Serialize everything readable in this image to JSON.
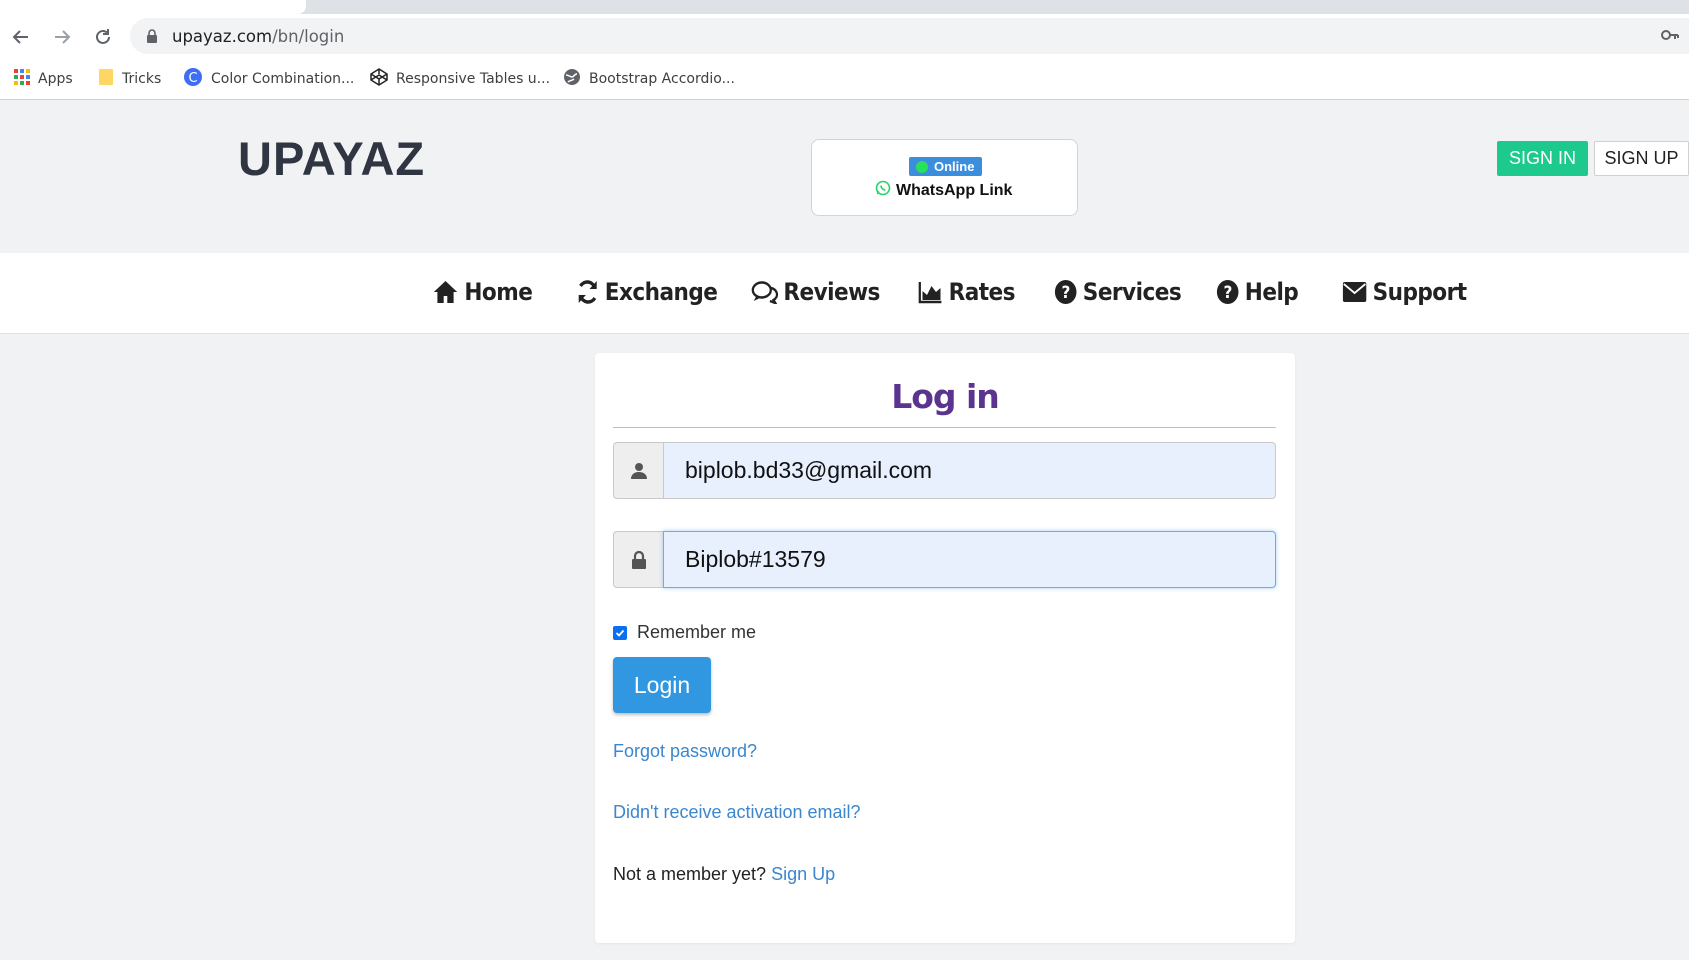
{
  "browser": {
    "url_host": "upayaz.com",
    "url_path": "/bn/login",
    "bookmarks": [
      {
        "label": "Apps",
        "icon": "apps-grid-icon"
      },
      {
        "label": "Tricks",
        "icon": "folder-icon"
      },
      {
        "label": "Color Combination...",
        "icon": "color-c-icon"
      },
      {
        "label": "Responsive Tables u...",
        "icon": "codepen-icon"
      },
      {
        "label": "Bootstrap Accordio...",
        "icon": "globe-icon"
      }
    ]
  },
  "header": {
    "logo": "UPAYAZ",
    "online_badge": "Online",
    "whatsapp_label": "WhatsApp Link",
    "sign_in": "SIGN IN",
    "sign_up": "SIGN UP"
  },
  "nav": {
    "items": [
      {
        "label": "Home",
        "icon": "home-icon"
      },
      {
        "label": "Exchange",
        "icon": "refresh-icon"
      },
      {
        "label": "Reviews",
        "icon": "comments-icon"
      },
      {
        "label": "Rates",
        "icon": "area-chart-icon"
      },
      {
        "label": "Services",
        "icon": "question-circle-icon"
      },
      {
        "label": "Help",
        "icon": "question-circle-icon"
      },
      {
        "label": "Support",
        "icon": "envelope-icon"
      }
    ]
  },
  "login": {
    "title": "Log in",
    "email_value": "biplob.bd33@gmail.com",
    "password_value": "Biplob#13579",
    "remember_label": "Remember me",
    "remember_checked": true,
    "login_button": "Login",
    "forgot_link": "Forgot password?",
    "activation_link": "Didn't receive activation email?",
    "not_member_text": "Not a member yet?",
    "signup_link": "Sign Up"
  },
  "colors": {
    "accent_green": "#1ec98e",
    "title_purple": "#5b3490",
    "button_blue": "#3197e0",
    "link_blue": "#3a86cf",
    "logo_accent": "#f0861c"
  }
}
